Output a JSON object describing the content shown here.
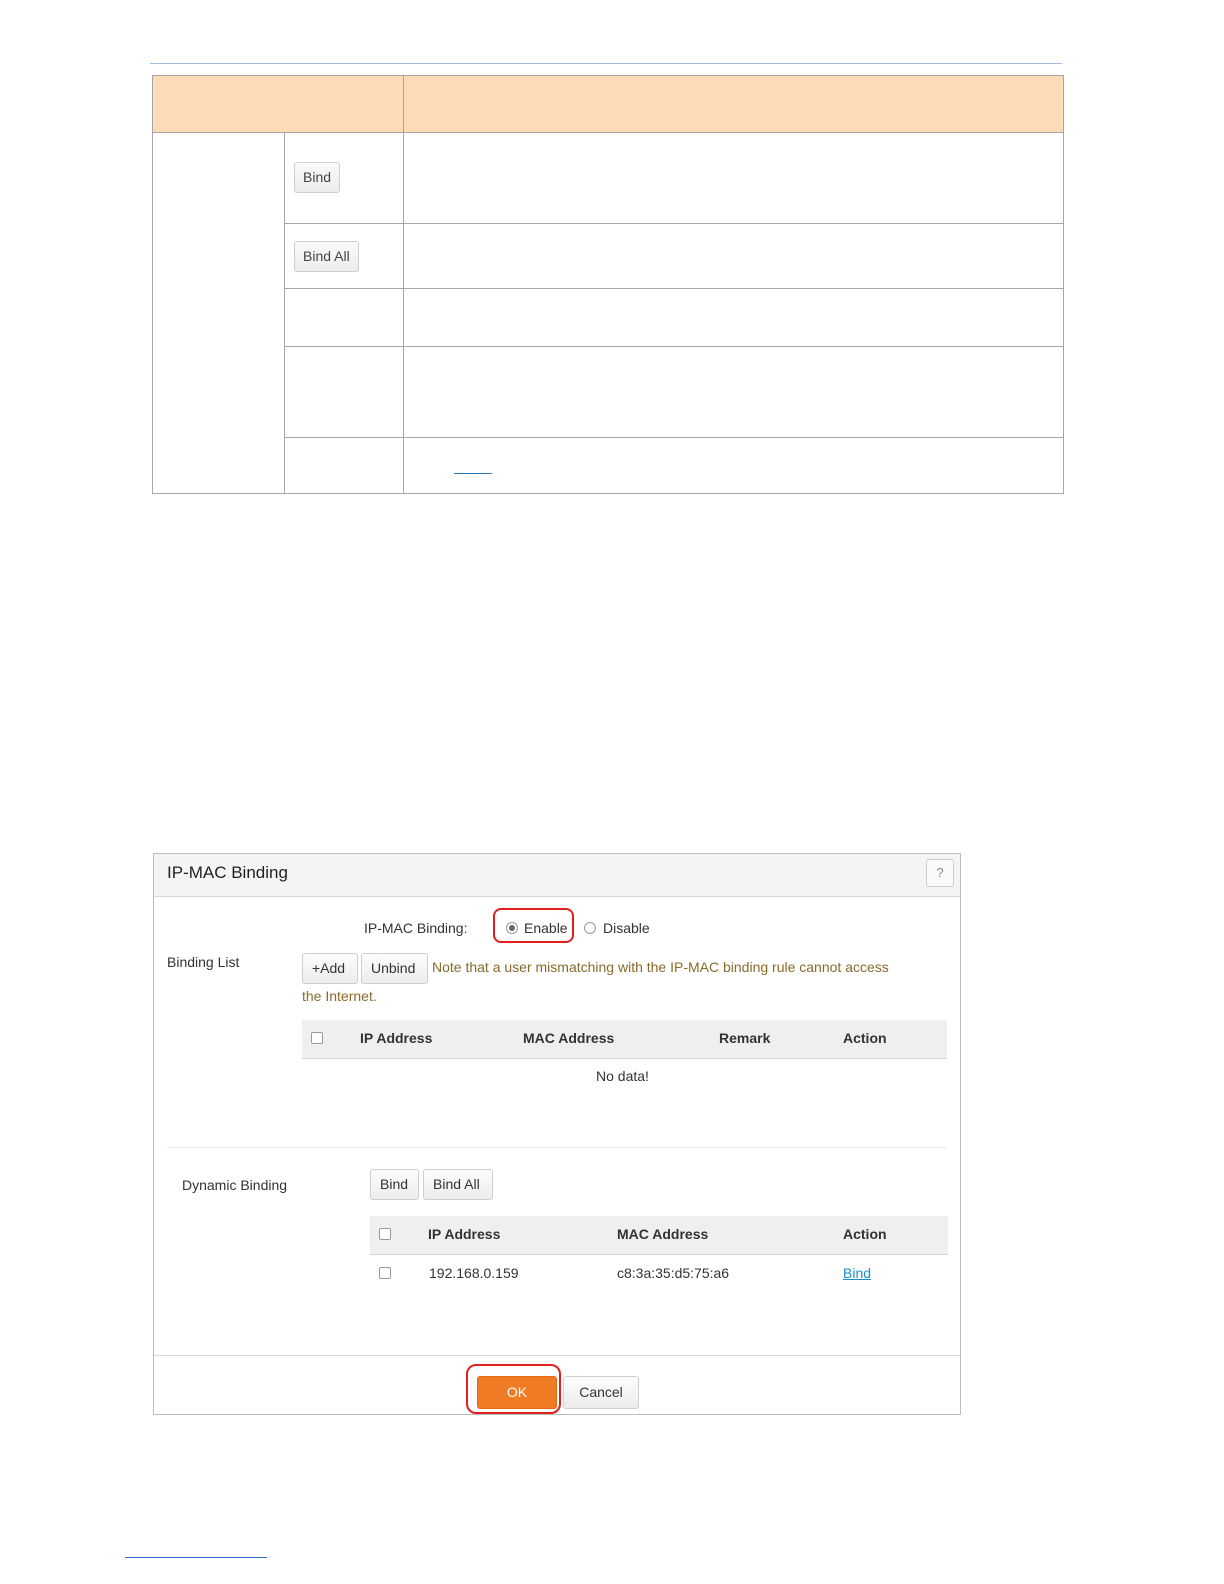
{
  "doc_table": {
    "buttons": [
      {
        "label": "Bind"
      },
      {
        "label": "Bind All"
      }
    ]
  },
  "dialog": {
    "title": "IP-MAC Binding",
    "help_label": "?",
    "binding_label": "IP-MAC Binding:",
    "enable_label": "Enable",
    "disable_label": "Disable",
    "binding_mode": "Enable",
    "binding_list_label": "Binding List",
    "add_label": "+Add",
    "unbind_label": "Unbind",
    "note_line1": "Note that a user mismatching with the IP-MAC binding rule cannot access",
    "note_line2": "the Internet.",
    "binding_table": {
      "headers": [
        "IP Address",
        "MAC Address",
        "Remark",
        "Action"
      ],
      "empty_text": "No data!"
    },
    "dynamic_binding_label": "Dynamic Binding",
    "bind_label": "Bind",
    "bind_all_label": "Bind All",
    "dynamic_table": {
      "headers": [
        "IP Address",
        "MAC Address",
        "Action"
      ],
      "rows": [
        {
          "ip": "192.168.0.159",
          "mac": "c8:3a:35:d5:75:a6",
          "action": "Bind"
        }
      ]
    },
    "ok_label": "OK",
    "cancel_label": "Cancel",
    "highlight_color": "#e02020",
    "ok_color": "#f07b25"
  }
}
